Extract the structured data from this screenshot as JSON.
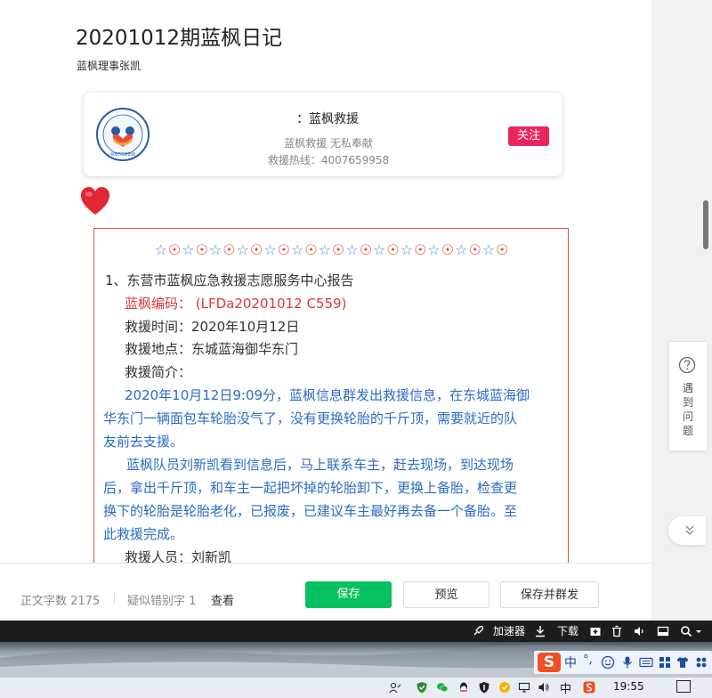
{
  "article": {
    "title": "20201012期蓝枫日记",
    "author": "蓝枫理事张凯"
  },
  "card": {
    "name": "：蓝枫救援",
    "slogan": "蓝枫救援  无私奉献",
    "hotline": "救援热线：4007659958",
    "follow": "关注",
    "logo_number": "4007659958"
  },
  "report": {
    "star": "☆",
    "circle": "☉",
    "pattern_pairs": 13,
    "heading": "1、东营市蓝枫应急救援志愿服务中心报告",
    "code": "蓝枫编码：   (LFDa20201012  C559)",
    "time": "救援时间：2020年10月12日",
    "place": "救援地点：东城蓝海御华东门",
    "intro_label": "救援简介：",
    "p1_l1": "2020年10月12日9:09分，蓝枫信息群发出救援信息，在东城蓝海御",
    "p1_l2": "华东门一辆面包车轮胎没气了，没有更换轮胎的千斤顶，需要就近的队",
    "p1_l3": "友前去支援。",
    "p2_l1": "蓝枫队员刘新凯看到信息后，马上联系车主，赶去现场，到达现场",
    "p2_l2": "后，拿出千斤顶，和车主一起把坏掉的轮胎卸下，更换上备胎，检查更",
    "p2_l3": "换下的轮胎是轮胎老化，已报废，已建议车主最好再去备一个备胎。至",
    "p2_l4": "此救援完成。",
    "rescuers": "救援人员：刘新凯"
  },
  "bottom": {
    "word_count": "正文字数  2175",
    "typo_count": "疑似错别字  1",
    "view": "查看",
    "save": "保存",
    "preview": "预览",
    "save_mass": "保存并群发"
  },
  "help": {
    "label": "遇到问题"
  },
  "toolbar": {
    "accelerator": "加速器",
    "download": "下载"
  },
  "ime": {
    "logo": "S",
    "mode": "中",
    "punct": "°,"
  },
  "taskbar": {
    "ime_indicator": "中",
    "time": "19:55"
  },
  "colors": {
    "accent_green": "#07c160",
    "follow_red": "#e8265b",
    "border_red": "#d9534f",
    "text_blue": "#2a6cc4",
    "text_red": "#d9383a",
    "star_blue": "#5c86d6",
    "circle_red": "#e0452f"
  },
  "icons": {
    "heart": "heart-icon",
    "help": "question-circle-icon",
    "collapse": "chevron-double-down-icon"
  }
}
